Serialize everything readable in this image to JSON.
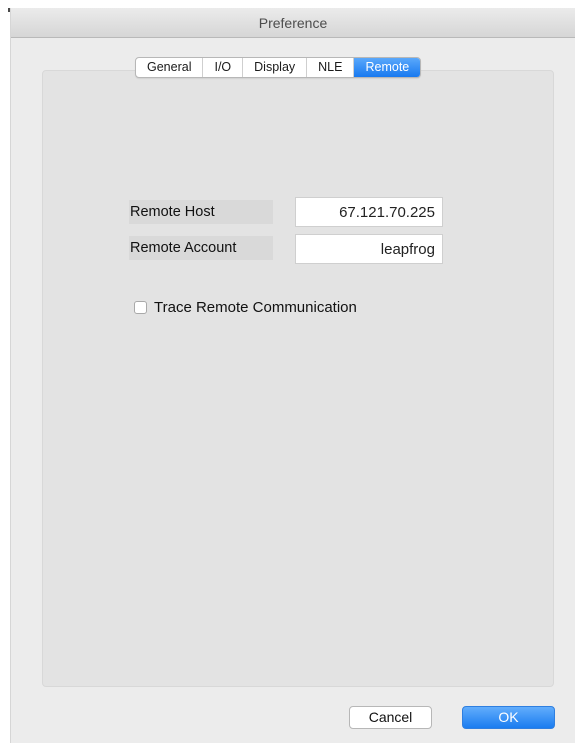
{
  "window": {
    "title": "Preference"
  },
  "tabs": [
    {
      "label": "General",
      "active": false
    },
    {
      "label": "I/O",
      "active": false
    },
    {
      "label": "Display",
      "active": false
    },
    {
      "label": "NLE",
      "active": false
    },
    {
      "label": "Remote",
      "active": true
    }
  ],
  "remote": {
    "host_label": "Remote Host",
    "host_value": "67.121.70.225",
    "account_label": "Remote Account",
    "account_value": "leapfrog",
    "trace_label": "Trace Remote Communication",
    "trace_checked": false
  },
  "buttons": {
    "cancel_label": "Cancel",
    "ok_label": "OK"
  },
  "colors": {
    "accent": "#1879f0",
    "window_bg": "#ececec",
    "panel_bg": "#e3e3e3"
  }
}
